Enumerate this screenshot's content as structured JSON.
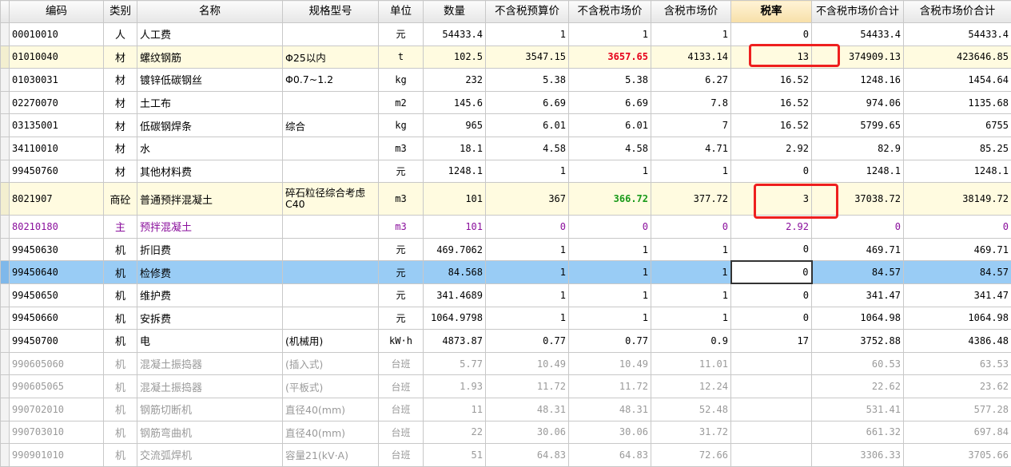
{
  "headers": [
    "编码",
    "类别",
    "名称",
    "规格型号",
    "单位",
    "数量",
    "不含税预算价",
    "不含税市场价",
    "含税市场价",
    "税率",
    "不含税市场价合计",
    "含税市场价合计"
  ],
  "row_indices": [
    "",
    "",
    "",
    "",
    "",
    "",
    "",
    "",
    "",
    "",
    "",
    "",
    "",
    "",
    "",
    "",
    "",
    "",
    ""
  ],
  "rows": [
    {
      "style": "",
      "code": "00010010",
      "type": "人",
      "name": "人工费",
      "spec": "",
      "unit": "元",
      "qty": "54433.4",
      "budget": "1",
      "market": "1",
      "tax_market": "1",
      "rate": "0",
      "sum_market": "54433.4",
      "sum_tax": "54433.4"
    },
    {
      "style": "hl-yellow",
      "code": "01010040",
      "type": "材",
      "name": "螺纹钢筋",
      "spec": "Φ25以内",
      "unit": "t",
      "qty": "102.5",
      "budget": "3547.15",
      "market": "3657.65",
      "tax_market": "4133.14",
      "rate": "13",
      "sum_market": "374909.13",
      "sum_tax": "423646.85",
      "market_cls": "red-bold"
    },
    {
      "style": "",
      "code": "01030031",
      "type": "材",
      "name": "镀锌低碳钢丝",
      "spec": "Φ0.7~1.2",
      "unit": "kg",
      "qty": "232",
      "budget": "5.38",
      "market": "5.38",
      "tax_market": "6.27",
      "rate": "16.52",
      "sum_market": "1248.16",
      "sum_tax": "1454.64"
    },
    {
      "style": "",
      "code": "02270070",
      "type": "材",
      "name": "土工布",
      "spec": "",
      "unit": "m2",
      "qty": "145.6",
      "budget": "6.69",
      "market": "6.69",
      "tax_market": "7.8",
      "rate": "16.52",
      "sum_market": "974.06",
      "sum_tax": "1135.68"
    },
    {
      "style": "",
      "code": "03135001",
      "type": "材",
      "name": "低碳钢焊条",
      "spec": "综合",
      "unit": "kg",
      "qty": "965",
      "budget": "6.01",
      "market": "6.01",
      "tax_market": "7",
      "rate": "16.52",
      "sum_market": "5799.65",
      "sum_tax": "6755"
    },
    {
      "style": "",
      "code": "34110010",
      "type": "材",
      "name": "水",
      "spec": "",
      "unit": "m3",
      "qty": "18.1",
      "budget": "4.58",
      "market": "4.58",
      "tax_market": "4.71",
      "rate": "2.92",
      "sum_market": "82.9",
      "sum_tax": "85.25"
    },
    {
      "style": "",
      "code": "99450760",
      "type": "材",
      "name": "其他材料费",
      "spec": "",
      "unit": "元",
      "qty": "1248.1",
      "budget": "1",
      "market": "1",
      "tax_market": "1",
      "rate": "0",
      "sum_market": "1248.1",
      "sum_tax": "1248.1"
    },
    {
      "style": "hl-yellow tall",
      "code": "8021907",
      "type": "商砼",
      "name": "普通预拌混凝土",
      "spec": "碎石粒径综合考虑 C40",
      "unit": "m3",
      "qty": "101",
      "budget": "367",
      "market": "366.72",
      "tax_market": "377.72",
      "rate": "3",
      "sum_market": "37038.72",
      "sum_tax": "38149.72",
      "market_cls": "green-bold"
    },
    {
      "style": "purple",
      "code": "80210180",
      "type": "主",
      "name": "预拌混凝土",
      "spec": "",
      "unit": "m3",
      "qty": "101",
      "budget": "0",
      "market": "0",
      "tax_market": "0",
      "rate": "2.92",
      "sum_market": "0",
      "sum_tax": "0"
    },
    {
      "style": "",
      "code": "99450630",
      "type": "机",
      "name": "折旧费",
      "spec": "",
      "unit": "元",
      "qty": "469.7062",
      "budget": "1",
      "market": "1",
      "tax_market": "1",
      "rate": "0",
      "sum_market": "469.71",
      "sum_tax": "469.71"
    },
    {
      "style": "hl-blue",
      "code": "99450640",
      "type": "机",
      "name": "检修费",
      "spec": "",
      "unit": "元",
      "qty": "84.568",
      "budget": "1",
      "market": "1",
      "tax_market": "1",
      "rate": "0",
      "sum_market": "84.57",
      "sum_tax": "84.57",
      "rate_cls": "active-cell"
    },
    {
      "style": "",
      "code": "99450650",
      "type": "机",
      "name": "维护费",
      "spec": "",
      "unit": "元",
      "qty": "341.4689",
      "budget": "1",
      "market": "1",
      "tax_market": "1",
      "rate": "0",
      "sum_market": "341.47",
      "sum_tax": "341.47"
    },
    {
      "style": "",
      "code": "99450660",
      "type": "机",
      "name": "安拆费",
      "spec": "",
      "unit": "元",
      "qty": "1064.9798",
      "budget": "1",
      "market": "1",
      "tax_market": "1",
      "rate": "0",
      "sum_market": "1064.98",
      "sum_tax": "1064.98"
    },
    {
      "style": "",
      "code": "99450700",
      "type": "机",
      "name": "电",
      "spec": "(机械用)",
      "unit": "kW·h",
      "qty": "4873.87",
      "budget": "0.77",
      "market": "0.77",
      "tax_market": "0.9",
      "rate": "17",
      "sum_market": "3752.88",
      "sum_tax": "4386.48"
    },
    {
      "style": "gray",
      "code": "990605060",
      "type": "机",
      "name": "混凝土振捣器",
      "spec": "(插入式)",
      "unit": "台班",
      "qty": "5.77",
      "budget": "10.49",
      "market": "10.49",
      "tax_market": "11.01",
      "rate": "",
      "sum_market": "60.53",
      "sum_tax": "63.53"
    },
    {
      "style": "gray",
      "code": "990605065",
      "type": "机",
      "name": "混凝土振捣器",
      "spec": "(平板式)",
      "unit": "台班",
      "qty": "1.93",
      "budget": "11.72",
      "market": "11.72",
      "tax_market": "12.24",
      "rate": "",
      "sum_market": "22.62",
      "sum_tax": "23.62"
    },
    {
      "style": "gray",
      "code": "990702010",
      "type": "机",
      "name": "钢筋切断机",
      "spec": "直径40(mm)",
      "unit": "台班",
      "qty": "11",
      "budget": "48.31",
      "market": "48.31",
      "tax_market": "52.48",
      "rate": "",
      "sum_market": "531.41",
      "sum_tax": "577.28"
    },
    {
      "style": "gray",
      "code": "990703010",
      "type": "机",
      "name": "钢筋弯曲机",
      "spec": "直径40(mm)",
      "unit": "台班",
      "qty": "22",
      "budget": "30.06",
      "market": "30.06",
      "tax_market": "31.72",
      "rate": "",
      "sum_market": "661.32",
      "sum_tax": "697.84"
    },
    {
      "style": "gray",
      "code": "990901010",
      "type": "机",
      "name": "交流弧焊机",
      "spec": "容量21(kV·A)",
      "unit": "台班",
      "qty": "51",
      "budget": "64.83",
      "market": "64.83",
      "tax_market": "72.66",
      "rate": "",
      "sum_market": "3306.33",
      "sum_tax": "3705.66"
    }
  ],
  "colors": {
    "accent_red": "#ee1f1f",
    "selected_row": "#99ccf5",
    "highlight_row": "#fffbe0",
    "green_value": "#1a9a1a",
    "red_value": "#e6001a",
    "purple_row": "#8a0f9c"
  }
}
